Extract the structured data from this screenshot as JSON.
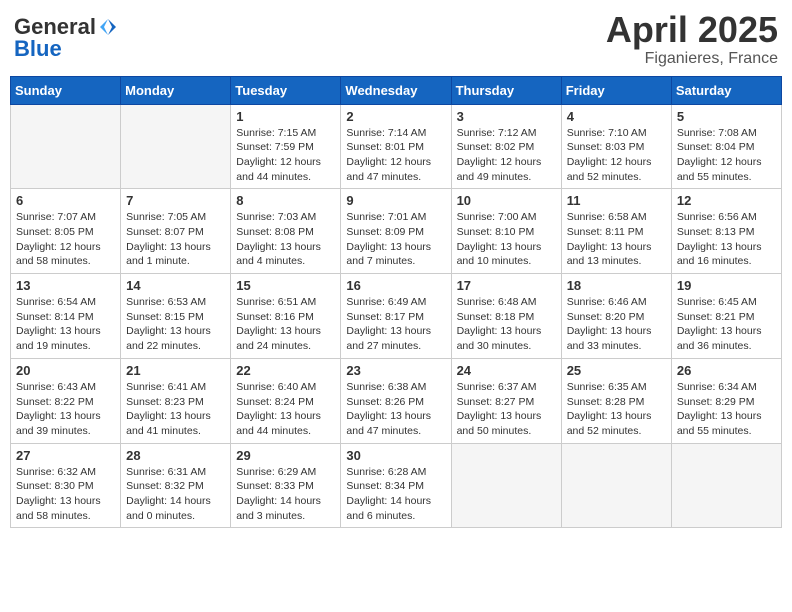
{
  "header": {
    "logo_general": "General",
    "logo_blue": "Blue",
    "title": "April 2025",
    "location": "Figanieres, France"
  },
  "days_of_week": [
    "Sunday",
    "Monday",
    "Tuesday",
    "Wednesday",
    "Thursday",
    "Friday",
    "Saturday"
  ],
  "weeks": [
    [
      {
        "day": "",
        "info": ""
      },
      {
        "day": "",
        "info": ""
      },
      {
        "day": "1",
        "info": "Sunrise: 7:15 AM\nSunset: 7:59 PM\nDaylight: 12 hours and 44 minutes."
      },
      {
        "day": "2",
        "info": "Sunrise: 7:14 AM\nSunset: 8:01 PM\nDaylight: 12 hours and 47 minutes."
      },
      {
        "day": "3",
        "info": "Sunrise: 7:12 AM\nSunset: 8:02 PM\nDaylight: 12 hours and 49 minutes."
      },
      {
        "day": "4",
        "info": "Sunrise: 7:10 AM\nSunset: 8:03 PM\nDaylight: 12 hours and 52 minutes."
      },
      {
        "day": "5",
        "info": "Sunrise: 7:08 AM\nSunset: 8:04 PM\nDaylight: 12 hours and 55 minutes."
      }
    ],
    [
      {
        "day": "6",
        "info": "Sunrise: 7:07 AM\nSunset: 8:05 PM\nDaylight: 12 hours and 58 minutes."
      },
      {
        "day": "7",
        "info": "Sunrise: 7:05 AM\nSunset: 8:07 PM\nDaylight: 13 hours and 1 minute."
      },
      {
        "day": "8",
        "info": "Sunrise: 7:03 AM\nSunset: 8:08 PM\nDaylight: 13 hours and 4 minutes."
      },
      {
        "day": "9",
        "info": "Sunrise: 7:01 AM\nSunset: 8:09 PM\nDaylight: 13 hours and 7 minutes."
      },
      {
        "day": "10",
        "info": "Sunrise: 7:00 AM\nSunset: 8:10 PM\nDaylight: 13 hours and 10 minutes."
      },
      {
        "day": "11",
        "info": "Sunrise: 6:58 AM\nSunset: 8:11 PM\nDaylight: 13 hours and 13 minutes."
      },
      {
        "day": "12",
        "info": "Sunrise: 6:56 AM\nSunset: 8:13 PM\nDaylight: 13 hours and 16 minutes."
      }
    ],
    [
      {
        "day": "13",
        "info": "Sunrise: 6:54 AM\nSunset: 8:14 PM\nDaylight: 13 hours and 19 minutes."
      },
      {
        "day": "14",
        "info": "Sunrise: 6:53 AM\nSunset: 8:15 PM\nDaylight: 13 hours and 22 minutes."
      },
      {
        "day": "15",
        "info": "Sunrise: 6:51 AM\nSunset: 8:16 PM\nDaylight: 13 hours and 24 minutes."
      },
      {
        "day": "16",
        "info": "Sunrise: 6:49 AM\nSunset: 8:17 PM\nDaylight: 13 hours and 27 minutes."
      },
      {
        "day": "17",
        "info": "Sunrise: 6:48 AM\nSunset: 8:18 PM\nDaylight: 13 hours and 30 minutes."
      },
      {
        "day": "18",
        "info": "Sunrise: 6:46 AM\nSunset: 8:20 PM\nDaylight: 13 hours and 33 minutes."
      },
      {
        "day": "19",
        "info": "Sunrise: 6:45 AM\nSunset: 8:21 PM\nDaylight: 13 hours and 36 minutes."
      }
    ],
    [
      {
        "day": "20",
        "info": "Sunrise: 6:43 AM\nSunset: 8:22 PM\nDaylight: 13 hours and 39 minutes."
      },
      {
        "day": "21",
        "info": "Sunrise: 6:41 AM\nSunset: 8:23 PM\nDaylight: 13 hours and 41 minutes."
      },
      {
        "day": "22",
        "info": "Sunrise: 6:40 AM\nSunset: 8:24 PM\nDaylight: 13 hours and 44 minutes."
      },
      {
        "day": "23",
        "info": "Sunrise: 6:38 AM\nSunset: 8:26 PM\nDaylight: 13 hours and 47 minutes."
      },
      {
        "day": "24",
        "info": "Sunrise: 6:37 AM\nSunset: 8:27 PM\nDaylight: 13 hours and 50 minutes."
      },
      {
        "day": "25",
        "info": "Sunrise: 6:35 AM\nSunset: 8:28 PM\nDaylight: 13 hours and 52 minutes."
      },
      {
        "day": "26",
        "info": "Sunrise: 6:34 AM\nSunset: 8:29 PM\nDaylight: 13 hours and 55 minutes."
      }
    ],
    [
      {
        "day": "27",
        "info": "Sunrise: 6:32 AM\nSunset: 8:30 PM\nDaylight: 13 hours and 58 minutes."
      },
      {
        "day": "28",
        "info": "Sunrise: 6:31 AM\nSunset: 8:32 PM\nDaylight: 14 hours and 0 minutes."
      },
      {
        "day": "29",
        "info": "Sunrise: 6:29 AM\nSunset: 8:33 PM\nDaylight: 14 hours and 3 minutes."
      },
      {
        "day": "30",
        "info": "Sunrise: 6:28 AM\nSunset: 8:34 PM\nDaylight: 14 hours and 6 minutes."
      },
      {
        "day": "",
        "info": ""
      },
      {
        "day": "",
        "info": ""
      },
      {
        "day": "",
        "info": ""
      }
    ]
  ]
}
